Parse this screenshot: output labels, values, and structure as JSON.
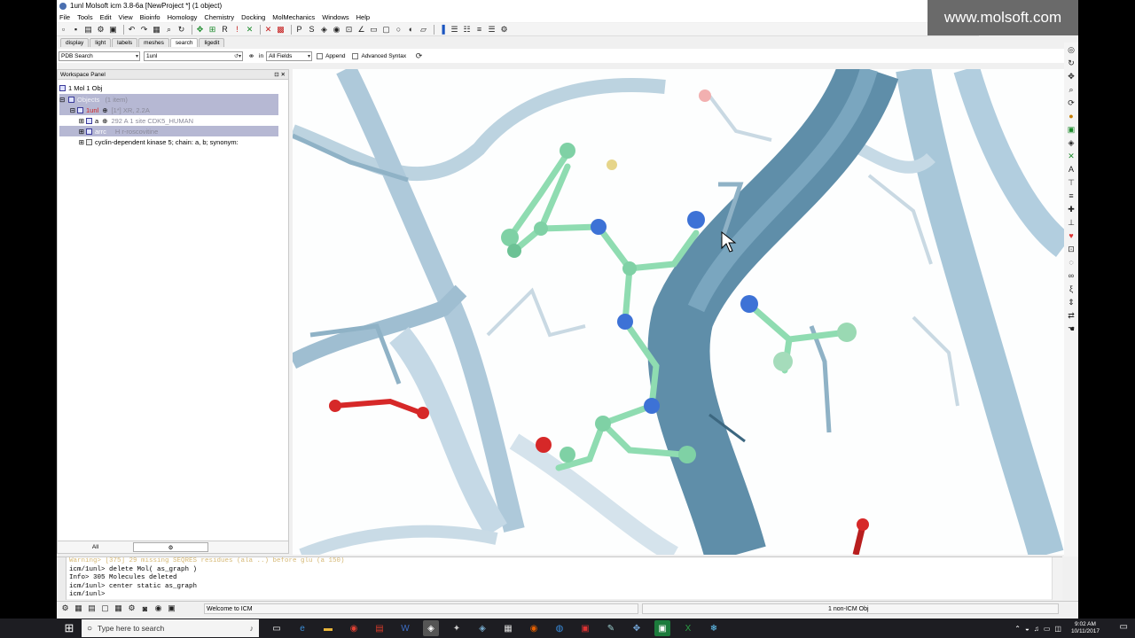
{
  "window": {
    "title": "1unl Molsoft icm 3.8-6a  [NewProject *] (1 object)",
    "watermark": "www.molsoft.com"
  },
  "menu": [
    "File",
    "Tools",
    "Edit",
    "View",
    "Bioinfo",
    "Homology",
    "Chemistry",
    "Docking",
    "MolMechanics",
    "Windows",
    "Help"
  ],
  "tabs": [
    "display",
    "light",
    "labels",
    "meshes",
    "search",
    "ligedit"
  ],
  "active_tab": "search",
  "search": {
    "source": "PDB Search",
    "query": "1unl",
    "in_label": "in",
    "field": "All Fields",
    "append_label": "Append",
    "advanced_label": "Advanced Syntax"
  },
  "workspace": {
    "header": "Workspace Panel",
    "root": "1 Mol 1 Obj",
    "objects_label": "Objects",
    "objects_count": "(1 item)",
    "object_name": "1unl",
    "object_info": "[1*] XR, 2.2A",
    "chain_a": "a",
    "chain_a_info": "292 A  1 site CDK5_HUMAN",
    "ligand": "arrc",
    "ligand_info": "H  r-roscovitine",
    "description": "cyclin-dependent kinase 5; chain: a, b; synonym:",
    "bottom_all": "All"
  },
  "terminal": {
    "lines": [
      "Warning> [375] 29 missing SEQRES residues (ala ..) before glu (a 150)",
      "icm/1unl> delete Mol( as_graph )",
      " Info> 305 Molecules deleted",
      "icm/1unl> center static as_graph",
      "icm/1unl> "
    ]
  },
  "status": {
    "welcome": "Welcome to ICM",
    "objects": "1 non-ICM Obj"
  },
  "taskbar": {
    "search_placeholder": "Type here to search",
    "time": "9:02 AM",
    "date": "10/11/2017"
  },
  "colors": {
    "ribbon_dark": "#5f8ea9",
    "ribbon_light": "#b9d2e0",
    "ligand": "#7fd1a5",
    "nitrogen": "#3d72d6",
    "oxygen": "#d62828",
    "sulfur": "#e6d58a",
    "selection": "#b6b8d3"
  }
}
